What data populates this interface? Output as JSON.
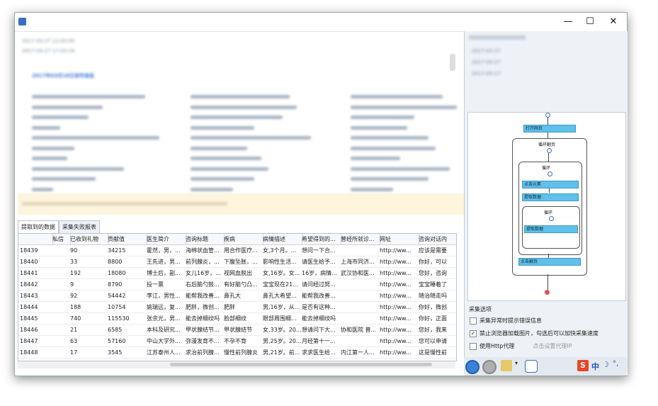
{
  "window": {
    "title": "",
    "min": "—",
    "max": "☐",
    "close": "✕"
  },
  "tabs": [
    "提取到的数据",
    "采集失败报表"
  ],
  "grid": {
    "columns": [
      "",
      "私信",
      "已收到礼物",
      "贡献值",
      "医生简介",
      "咨询标题",
      "疾病",
      "病情描述",
      "希望得到的...",
      "曾经所就诊...",
      "网址",
      "咨询对话内"
    ],
    "rows": [
      [
        "18439",
        "",
        "90",
        "34215",
        "霍然，男，...",
        "海绵状血管...",
        "用合作医疗...",
        "女,3个月。...",
        "想问一下合...",
        "",
        "http://ww...",
        "应该是需要"
      ],
      [
        "18440",
        "",
        "33",
        "8800",
        "王先进，男...",
        "前列腺炎，...",
        "下腹坠胀，...",
        "影响性生活...",
        "请医生给予...",
        "上海市同济...",
        "http://ww...",
        "你好，可以"
      ],
      [
        "18441",
        "",
        "192",
        "18080",
        "博士后，副...",
        "女儿16岁，...",
        "视网血脱出",
        "女,16岁。女...",
        "16岁，病情...",
        "武汉协和医...",
        "http://ww...",
        "您好，咨询"
      ],
      [
        "18442",
        "",
        "9",
        "8790",
        "投一票",
        "右后脑勺鼓...",
        "有好脑勺凸...",
        "宝宝现在21...",
        "请问经过努...",
        "",
        "http://ww...",
        "宝宝睡着了"
      ],
      [
        "18443",
        "",
        "92",
        "54442",
        "李江，男性...",
        "能帮我改善...",
        "鼻孔大",
        "鼻孔大希望...",
        "能帮我改善...",
        "",
        "http://ww...",
        "随治随走吗"
      ],
      [
        "18444",
        "",
        "188",
        "10754",
        "姚瑞远，复...",
        "肥胖，微创...",
        "肥胖",
        "男,16岁，从...",
        "是否有这种...",
        "",
        "http://ww...",
        "你好，微创"
      ],
      [
        "18445",
        "",
        "740",
        "115530",
        "张余光，男...",
        "能去掉细纹吗",
        "脸部细纹",
        "眼部周围细...",
        "能去掉细纹吗",
        "",
        "http://ww...",
        "你好，正面"
      ],
      [
        "18446",
        "",
        "21",
        "6585",
        "本科及研究...",
        "甲状腺结节...",
        "甲状腺结节",
        "女,33岁。20...",
        "想请问下大...",
        "协和医院 普...",
        "http://ww...",
        "您好，我来"
      ],
      [
        "18447",
        "",
        "63",
        "57160",
        "中山大学外...",
        "弥漫发育不...",
        "不孕不育",
        "男,25岁。20...",
        "月经第十一...",
        "",
        "http://ww...",
        "您可以申请"
      ],
      [
        "18448",
        "",
        "17",
        "3545",
        "江苏泰州人...",
        "求治前列腺...",
        "慢性前列腺炎",
        "男,21岁。前...",
        "求求医生给...",
        "内江第一人...",
        "http://ww...",
        "这是慢性前"
      ]
    ]
  },
  "flow": {
    "open_page": "打开网页",
    "loop_pages": "循环翻页",
    "loop": "循环",
    "click_element": "点击元素",
    "extract_data": "提取数据",
    "loop_inner": "循环",
    "extract_data2": "提取数据",
    "click_next": "点击翻页"
  },
  "options": {
    "title": "采集选项",
    "opt1": "采集异常时提示错误信息",
    "opt2": "禁止浏览器加载图片，勾选后可以加快采集速度",
    "opt3": "使用Http代理",
    "proxy_link": "点击设置代理IP"
  },
  "ime": {
    "logo": "S",
    "text": "中",
    "moon": "☽",
    "dot": "°,"
  },
  "colors": {
    "accent": "#3a6fc4",
    "flowbar": "#5fc0ea",
    "yellow": "#fdf5dc"
  },
  "blurred_lines": {
    "header1": "2017-03-27 12:03:00",
    "header2": "2017-03-27 17:03:18",
    "section": "2017年03月18日发布信息",
    "right1": "2017-03-27",
    "right2": "2017-03-27",
    "right3": "2017-03-27"
  }
}
